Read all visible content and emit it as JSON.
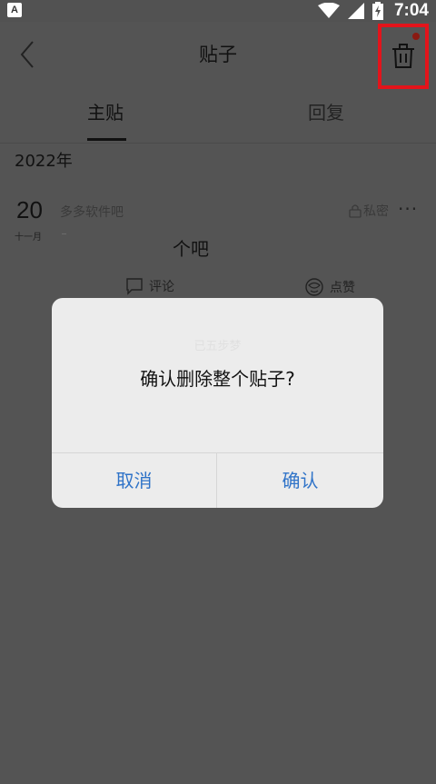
{
  "status_bar": {
    "app_badge": "A",
    "time": "7:04",
    "icons": [
      "wifi-icon",
      "signal-icon",
      "battery-charging-icon"
    ]
  },
  "header": {
    "title": "贴子",
    "back_icon": "chevron-left-icon",
    "delete_icon": "trash-icon",
    "highlight_color": "#e3141b"
  },
  "tabs": [
    {
      "label": "主贴",
      "active": true
    },
    {
      "label": "回复",
      "active": false
    }
  ],
  "post": {
    "year": "2022年",
    "day": "20",
    "month": "十一月",
    "author": "多多软件吧",
    "privacy": "私密",
    "more": "···",
    "text": "个吧",
    "comment_label": "评论",
    "like_label": "点赞"
  },
  "dialog": {
    "ghost_text": "已五步梦",
    "message": "确认删除整个贴子?",
    "cancel_label": "取消",
    "confirm_label": "确认",
    "button_color": "#2f73c8"
  }
}
